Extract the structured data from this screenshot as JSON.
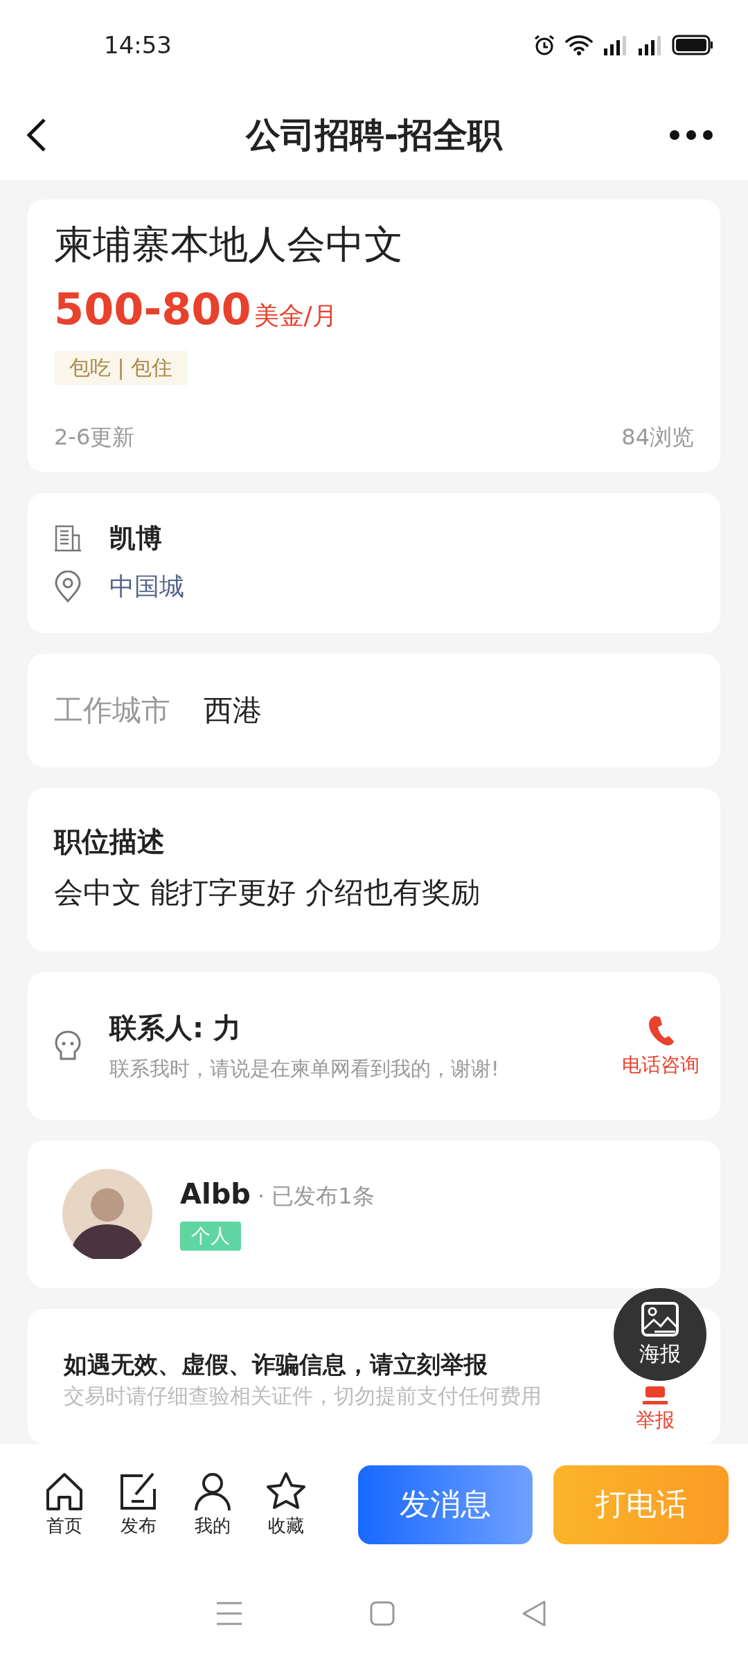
{
  "status_bar": {
    "time": "14:53"
  },
  "header": {
    "title": "公司招聘-招全职"
  },
  "job": {
    "title": "柬埔寨本地人会中文",
    "salary": "500-800",
    "salary_unit": "美金/月",
    "tag": "包吃 | 包住",
    "updated": "2-6更新",
    "views": "84浏览"
  },
  "company": {
    "name": "凯博",
    "location": "中国城"
  },
  "work_city": {
    "label": "工作城市",
    "value": "西港"
  },
  "description": {
    "title": "职位描述",
    "text": "会中文 能打字更好 介绍也有奖励"
  },
  "contact": {
    "name": "联系人: 力",
    "note": "联系我时，请说是在柬单网看到我的，谢谢!",
    "call_label": "电话咨询"
  },
  "publisher": {
    "name": "Albb",
    "post_count": "· 已发布1条",
    "tag": "个人"
  },
  "floating_poster": {
    "label": "海报"
  },
  "report": {
    "title": "如遇无效、虚假、诈骗信息，请立刻举报",
    "subtitle": "交易时请仔细查验相关证件，切勿提前支付任何费用",
    "label": "举报"
  },
  "bottom_nav": [
    {
      "label": "首页",
      "kind": "home"
    },
    {
      "label": "发布",
      "kind": "publish"
    },
    {
      "label": "我的",
      "kind": "profile"
    },
    {
      "label": "收藏",
      "kind": "favorite"
    }
  ],
  "actions": [
    {
      "label": "发消息",
      "kind": "message"
    },
    {
      "label": "打电话",
      "kind": "call"
    }
  ]
}
